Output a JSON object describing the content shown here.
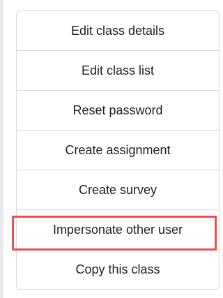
{
  "menu": {
    "items": [
      {
        "label": "Edit class details"
      },
      {
        "label": "Edit class list"
      },
      {
        "label": "Reset password"
      },
      {
        "label": "Create assignment"
      },
      {
        "label": "Create survey"
      },
      {
        "label": "Impersonate other user"
      },
      {
        "label": "Copy this class"
      }
    ]
  },
  "highlight": {
    "color": "#f14b4b",
    "target_item": "Impersonate other user"
  }
}
